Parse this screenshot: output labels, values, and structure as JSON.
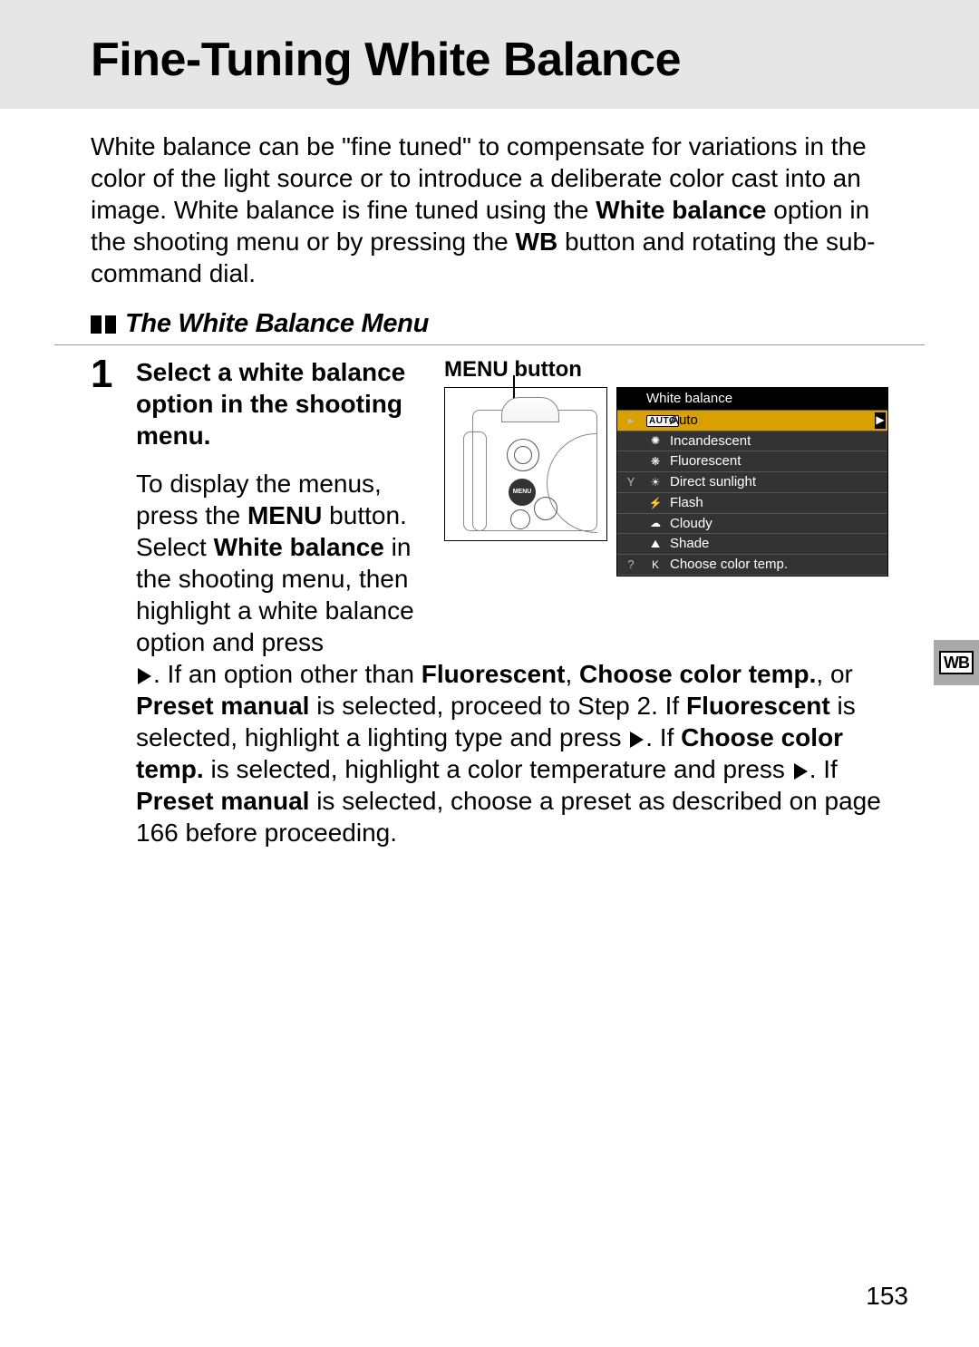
{
  "title": "Fine-Tuning White Balance",
  "intro": {
    "t1": "White balance can be \"fine tuned\" to compensate for variations in the color of the light source or to introduce a deliberate color cast into an image.  White balance is fine tuned using the ",
    "b1": "White balance",
    "t2": " option in the shooting menu or by pressing the ",
    "b2": "WB",
    "t3": " button and rotating the sub-command dial."
  },
  "section_title": "The White Balance Menu",
  "step": {
    "num": "1",
    "head": "Select a white balance option in the shooting menu.",
    "menu_button_label": "MENU button",
    "p1a": "To display the menus, press the ",
    "p1b_cond": "MENU",
    "p1c": " button. Select ",
    "p1d_bold": "White balance",
    "p1e": " in the shooting menu, then highlight a white balance option and press ",
    "p2a": ".  If an option other than ",
    "p2b_bold": "Fluorescent",
    "p2c": ", ",
    "p2d_bold": "Choose color temp.",
    "p2e": ", or ",
    "p2f_bold": "Preset manual",
    "p2g": " is selected, proceed to Step 2.  If ",
    "p2h_bold": "Fluorescent",
    "p2i": " is selected, highlight a lighting type and press ",
    "p3a": ". If ",
    "p3b_bold": "Choose color temp.",
    "p3c": " is selected, highlight a color temperature and press ",
    "p4a": ".  If ",
    "p4b_bold": "Preset manual",
    "p4c": " is selected, choose a preset as described on page 166 before proceeding."
  },
  "menu_screenshot": {
    "title": "White balance",
    "items": [
      {
        "side": "▸",
        "icon": "AUTO",
        "label": "Auto",
        "selected": true
      },
      {
        "side": "",
        "icon": "✺",
        "label": "Incandescent"
      },
      {
        "side": "",
        "icon": "❋",
        "label": "Fluorescent"
      },
      {
        "side": "Y",
        "icon": "☀",
        "label": "Direct sunlight"
      },
      {
        "side": "",
        "icon": "⚡",
        "label": "Flash"
      },
      {
        "side": "",
        "icon": "☁",
        "label": "Cloudy"
      },
      {
        "side": "",
        "icon": "⛰",
        "label": "Shade"
      },
      {
        "side": "?",
        "icon": "K",
        "label": "Choose color temp."
      }
    ]
  },
  "side_tab": "WB",
  "page_number": "153"
}
